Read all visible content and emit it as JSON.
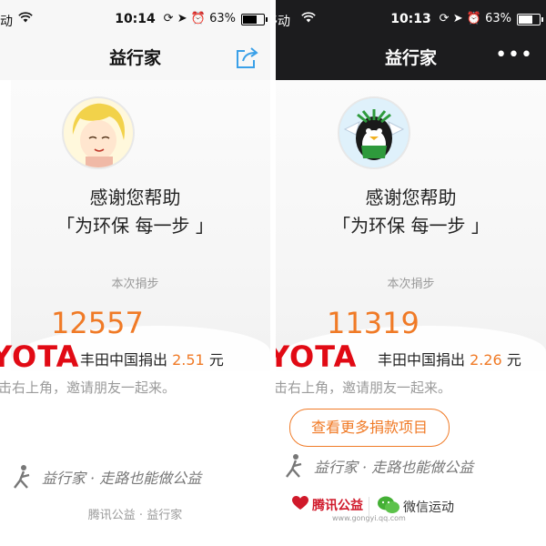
{
  "left": {
    "status": {
      "carrier": "动",
      "time": "10:14",
      "battery": "63%"
    },
    "nav": {
      "title": "益行家"
    },
    "card": {
      "thanks": "感谢您帮助",
      "slogan": "「为环保 每一步 」",
      "steps_label": "本次捐步",
      "steps": "12557",
      "brand": "YOTA",
      "donate_text": "丰田中国捐出",
      "amount": "2.51",
      "unit": "元",
      "invite": "击右上角，邀请朋友一起来。"
    },
    "signature": "益行家 · 走路也能做公益",
    "footer": "腾讯公益 · 益行家"
  },
  "right": {
    "status": {
      "carrier": "移动",
      "time": "10:13",
      "battery": "63%"
    },
    "nav": {
      "title": "益行家",
      "more": "•••"
    },
    "card": {
      "thanks": "感谢您帮助",
      "slogan": "「为环保 每一步 」",
      "steps_label": "本次捐步",
      "steps": "11319",
      "brand": "YOTA",
      "donate_text": "丰田中国捐出",
      "amount": "2.26",
      "unit": "元",
      "invite": "击右上角，邀请朋友一起来。"
    },
    "more_projects_button": "查看更多捐款项目",
    "signature": "益行家 · 走路也能做公益",
    "partners": {
      "tencent": "腾讯公益",
      "tencent_url": "www.gongyi.qq.com",
      "wechat": "微信运动"
    }
  },
  "colors": {
    "accent": "#f07a26",
    "brand_red": "#e10a14",
    "nav_dark": "#1c1c1e",
    "gray_text": "#9a9a9a"
  },
  "icons": [
    "wifi-icon",
    "lock-rotation-icon",
    "location-arrow-icon",
    "alarm-icon",
    "battery-icon",
    "share-icon",
    "more-icon",
    "avatar",
    "heart-logo-icon",
    "wechat-icon"
  ],
  "battery_level": 0.63
}
